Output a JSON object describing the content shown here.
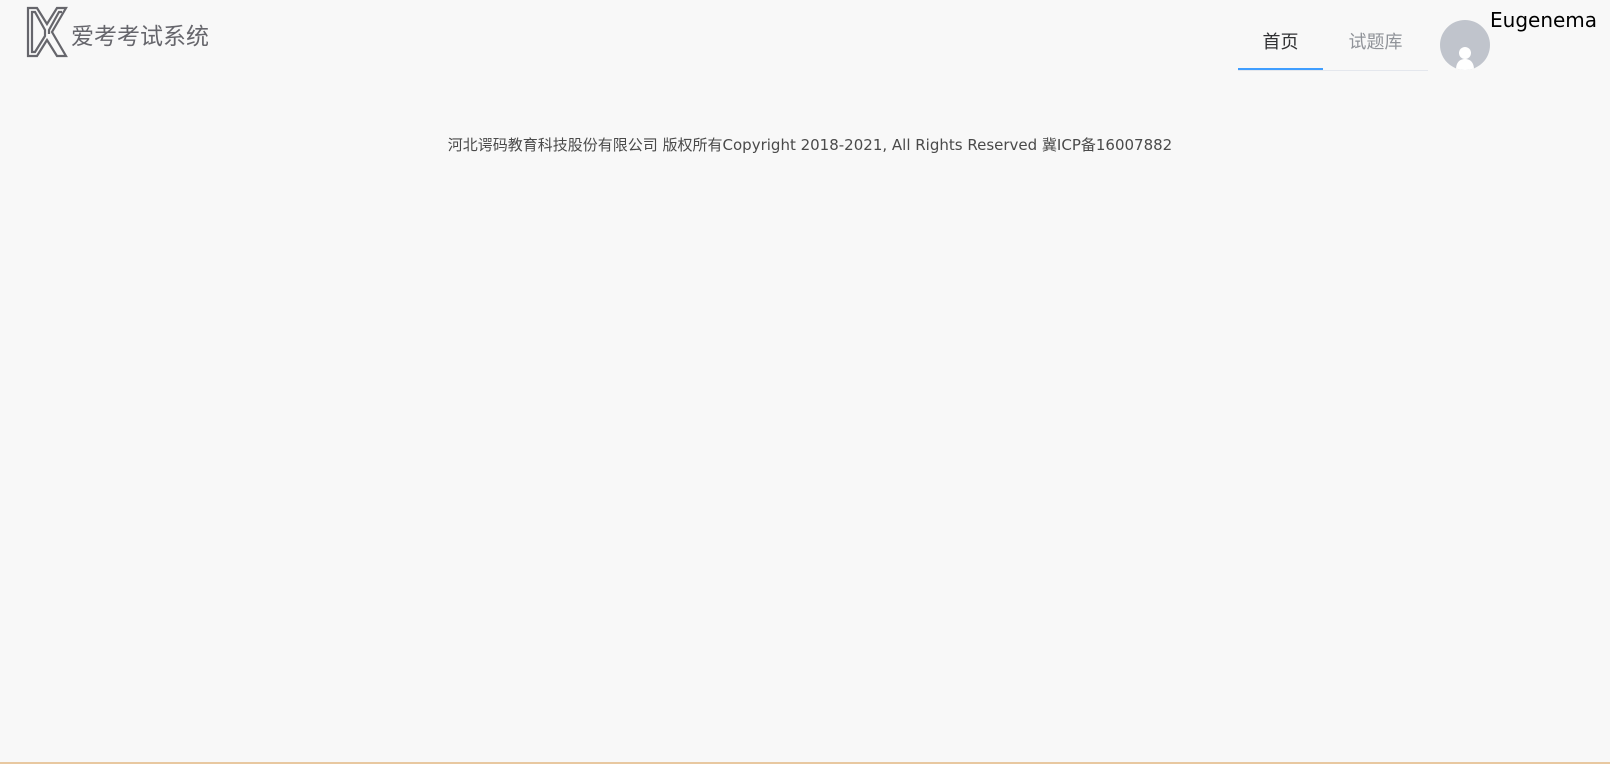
{
  "header": {
    "logo_text": "爱考考试系统",
    "logo_icon": "kx-logo-icon",
    "nav": [
      {
        "label": "首页",
        "active": true
      },
      {
        "label": "试题库",
        "active": false
      }
    ],
    "user": {
      "name": "Eugenema",
      "avatar_icon": "user-avatar-icon"
    }
  },
  "footer": {
    "copyright": "河北谔码教育科技股份有限公司 版权所有Copyright 2018-2021, All Rights Reserved 冀ICP备16007882"
  },
  "colors": {
    "background": "#f8f8f8",
    "accent": "#409eff",
    "logo": "#66666c",
    "avatar_bg": "#c0c4cc"
  }
}
